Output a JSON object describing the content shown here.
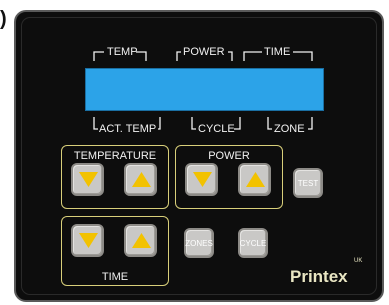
{
  "display": {
    "top_labels": [
      "TEMP",
      "POWER",
      "TIME"
    ],
    "bottom_labels": [
      "ACT. TEMP",
      "CYCLE",
      "ZONE"
    ],
    "lcd_color": "#2ca3e8"
  },
  "groups": {
    "temperature": {
      "label": "TEMPERATURE"
    },
    "power": {
      "label": "POWER"
    },
    "time": {
      "label": "TIME"
    }
  },
  "buttons": {
    "test_label": "TEST",
    "zones_label": "ZONES",
    "cycle_label": "CYCLE",
    "arrow_color": "#f2c200",
    "button_color": "#c9c8c6"
  },
  "brand": {
    "name": "Printex",
    "superscript": "UK",
    "logo_icon": "printex-logo"
  }
}
